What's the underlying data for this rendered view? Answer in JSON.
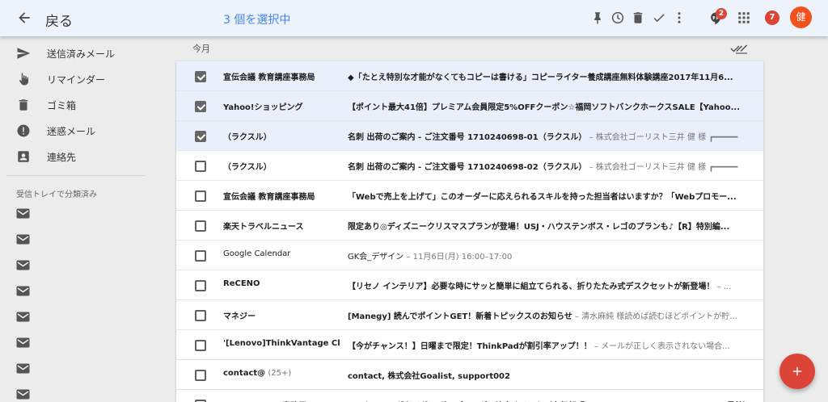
{
  "header": {
    "back_label": "戻る",
    "selected_text": "3 個を選択中",
    "chat_badge": "2",
    "notification_count": "7",
    "avatar_initial": "健",
    "colors": {
      "accent": "#4285f4",
      "alert": "#db4437",
      "avatar": "#f4511e"
    }
  },
  "sidebar": {
    "items": [
      {
        "label": "送信済みメール",
        "icon": "send-icon"
      },
      {
        "label": "リマインダー",
        "icon": "reminder-hand-icon"
      },
      {
        "label": "ゴミ箱",
        "icon": "trash-icon"
      },
      {
        "label": "迷惑メール",
        "icon": "spam-icon"
      },
      {
        "label": "連絡先",
        "icon": "contacts-icon"
      }
    ],
    "section_title": "受信トレイで分類済み",
    "label_icon": "mail-label-icon"
  },
  "list": {
    "section_header": "今月",
    "rows": [
      {
        "sender": "宣伝会議 教育講座事務局",
        "sender_count": "",
        "subject": "◆「たとえ特別な才能がなくてもコピーは書ける」コピーライター養成講座無料体験講座2017年11月6...",
        "snippet": "",
        "unread": true,
        "checked": true
      },
      {
        "sender": "Yahoo!ショッピング",
        "sender_count": "",
        "subject": "【ポイント最大41倍】プレミアム会員限定5%OFFクーポン☆福岡ソフトバンクホークスSALE【Yahoo...",
        "snippet": "",
        "unread": true,
        "checked": true
      },
      {
        "sender": "（ラクスル）",
        "sender_count": "",
        "subject": "名刺 出荷のご案内 - ご注文番号 1710240698-01（ラクスル）",
        "snippet": " – 株式会社ゴーリスト三井 健 様 ┏━━━━━",
        "unread": true,
        "checked": true
      },
      {
        "sender": "（ラクスル）",
        "sender_count": "",
        "subject": "名刺 出荷のご案内 - ご注文番号 1710240698-02（ラクスル）",
        "snippet": " – 株式会社ゴーリスト三井 健 様 ┏━━━━━",
        "unread": true,
        "checked": false
      },
      {
        "sender": "宣伝会議 教育講座事務局",
        "sender_count": "",
        "subject": "「Webで売上を上げて」このオーダーに応えられるスキルを持った担当者はいますか？「Webプロモー...",
        "snippet": "",
        "unread": true,
        "checked": false
      },
      {
        "sender": "楽天トラベルニュース",
        "sender_count": "",
        "subject": "限定あり◎ディズニークリスマスプランが登場！USJ・ハウステンボス・レゴのプランも♪【R】特別編...",
        "snippet": "",
        "unread": true,
        "checked": false
      },
      {
        "sender": "Google Calendar",
        "sender_count": "",
        "subject": "GK会_デザイン",
        "snippet": " – 11月6日(月) 16:00–17:00",
        "unread": false,
        "checked": false
      },
      {
        "sender": "ReCENO",
        "sender_count": "",
        "subject": "【リセノ インテリア】必要な時にサッと簡単に組立てられる、折りたたみ式デスクセットが新登場！",
        "snippet": " – ...",
        "unread": true,
        "checked": false
      },
      {
        "sender": "マネジー",
        "sender_count": "",
        "subject": "[Manegy] 読んでポイントGET！新着トピックスのお知らせ",
        "snippet": " – 清水麻純 様読めば読むほどポイントが貯...",
        "unread": true,
        "checked": false
      },
      {
        "sender": "'[Lenovo]ThinkVantage Clu.",
        "sender_count": "",
        "subject": "【今がチャンス！】日曜まで限定！ThinkPadが割引率アップ！！",
        "snippet": " – メールが正しく表示されない場合...",
        "unread": true,
        "checked": false
      },
      {
        "sender": "contact@",
        "sender_count": " (25+)",
        "subject": "contact, 株式会社Goalist, support002",
        "snippet": "",
        "unread": true,
        "checked": false
      },
      {
        "sender": "SHOEISHA iD事務局",
        "sender_count": "",
        "subject": "マーケティングタイガー ガーデニングに注文するワケ（宣伝部『MarkeZine』SHOEISHA iD News号外）",
        "snippet": "",
        "unread": true,
        "checked": false
      }
    ]
  }
}
